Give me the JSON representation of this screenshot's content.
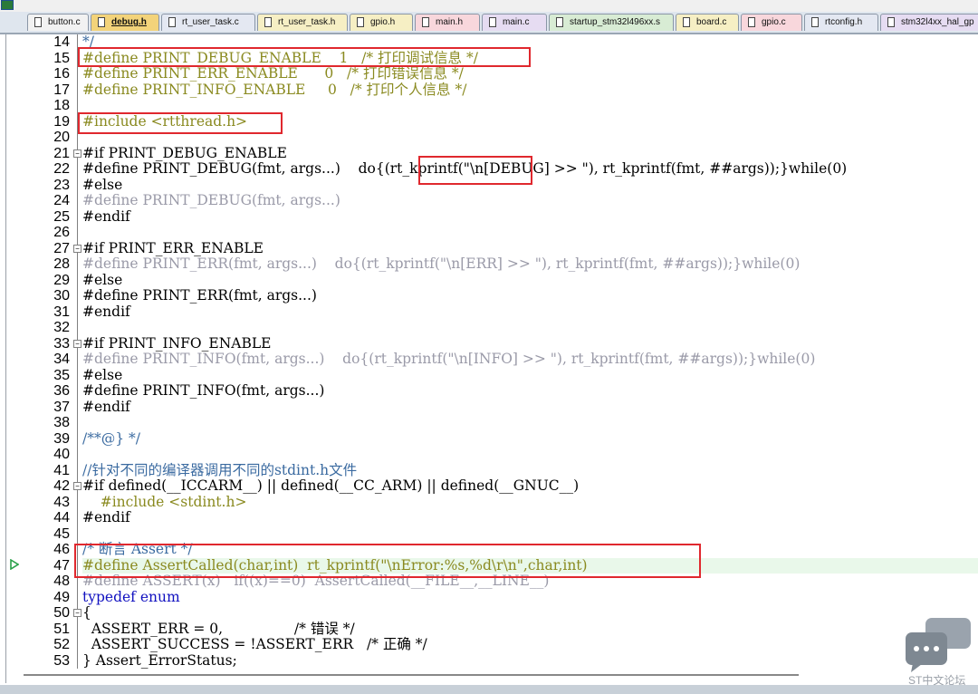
{
  "tabs": [
    {
      "label": "button.c",
      "active": false
    },
    {
      "label": "debug.h",
      "active": true
    },
    {
      "label": "rt_user_task.c",
      "active": false
    },
    {
      "label": "rt_user_task.h",
      "active": false
    },
    {
      "label": "gpio.h",
      "active": false
    },
    {
      "label": "main.h",
      "active": false
    },
    {
      "label": "main.c",
      "active": false
    },
    {
      "label": "startup_stm32l496xx.s",
      "active": false
    },
    {
      "label": "board.c",
      "active": false
    },
    {
      "label": "gpio.c",
      "active": false
    },
    {
      "label": "rtconfig.h",
      "active": false
    },
    {
      "label": "stm32l4xx_hal_gp",
      "active": false
    }
  ],
  "editor": {
    "lines": [
      {
        "n": "14",
        "t": "*/"
      },
      {
        "n": "15",
        "t": "#define PRINT_DEBUG_ENABLE    1   /* 打印调试信息 */"
      },
      {
        "n": "16",
        "t": "#define PRINT_ERR_ENABLE      0   /* 打印错误信息 */"
      },
      {
        "n": "17",
        "t": "#define PRINT_INFO_ENABLE     0   /* 打印个人信息 */"
      },
      {
        "n": "18",
        "t": ""
      },
      {
        "n": "19",
        "t": "#include <rtthread.h>"
      },
      {
        "n": "20",
        "t": ""
      },
      {
        "n": "21",
        "t": "#if PRINT_DEBUG_ENABLE"
      },
      {
        "n": "22",
        "t": "#define PRINT_DEBUG(fmt, args...)    do{(rt_kprintf(\"\\n[DEBUG] >> \"), rt_kprintf(fmt, ##args));}while(0)"
      },
      {
        "n": "23",
        "t": "#else"
      },
      {
        "n": "24",
        "t": "#define PRINT_DEBUG(fmt, args...)"
      },
      {
        "n": "25",
        "t": "#endif"
      },
      {
        "n": "26",
        "t": ""
      },
      {
        "n": "27",
        "t": "#if PRINT_ERR_ENABLE"
      },
      {
        "n": "28",
        "t": "#define PRINT_ERR(fmt, args...)    do{(rt_kprintf(\"\\n[ERR] >> \"), rt_kprintf(fmt, ##args));}while(0)"
      },
      {
        "n": "29",
        "t": "#else"
      },
      {
        "n": "30",
        "t": "#define PRINT_ERR(fmt, args...)"
      },
      {
        "n": "31",
        "t": "#endif"
      },
      {
        "n": "32",
        "t": ""
      },
      {
        "n": "33",
        "t": "#if PRINT_INFO_ENABLE"
      },
      {
        "n": "34",
        "t": "#define PRINT_INFO(fmt, args...)    do{(rt_kprintf(\"\\n[INFO] >> \"), rt_kprintf(fmt, ##args));}while(0)"
      },
      {
        "n": "35",
        "t": "#else"
      },
      {
        "n": "36",
        "t": "#define PRINT_INFO(fmt, args...)"
      },
      {
        "n": "37",
        "t": "#endif"
      },
      {
        "n": "38",
        "t": ""
      },
      {
        "n": "39",
        "t": "/**@} */"
      },
      {
        "n": "40",
        "t": ""
      },
      {
        "n": "41",
        "t": "//针对不同的编译器调用不同的stdint.h文件"
      },
      {
        "n": "42",
        "t": "#if defined(__ICCARM__) || defined(__CC_ARM) || defined(__GNUC__)"
      },
      {
        "n": "43",
        "t": "    #include <stdint.h>"
      },
      {
        "n": "44",
        "t": "#endif"
      },
      {
        "n": "45",
        "t": ""
      },
      {
        "n": "46",
        "t": "/* 断言 Assert */"
      },
      {
        "n": "47",
        "t": "#define AssertCalled(char,int)  rt_kprintf(\"\\nError:%s,%d\\r\\n\",char,int)"
      },
      {
        "n": "48",
        "t": "#define ASSERT(x)   if((x)==0)  AssertCalled(__FILE__,__LINE__)"
      },
      {
        "n": "49",
        "t": "typedef enum"
      },
      {
        "n": "50",
        "t": "{"
      },
      {
        "n": "51",
        "t": "  ASSERT_ERR = 0,                /* 错误 */"
      },
      {
        "n": "52",
        "t": "  ASSERT_SUCCESS = !ASSERT_ERR   /* 正确 */"
      },
      {
        "n": "53",
        "t": "} Assert_ErrorStatus;"
      }
    ]
  },
  "watermark": {
    "text": "ST中文论坛"
  },
  "colors": {
    "highlight_box": "#e0282e",
    "current_line": "#e9f8ea",
    "selection": "#c9eefa"
  }
}
